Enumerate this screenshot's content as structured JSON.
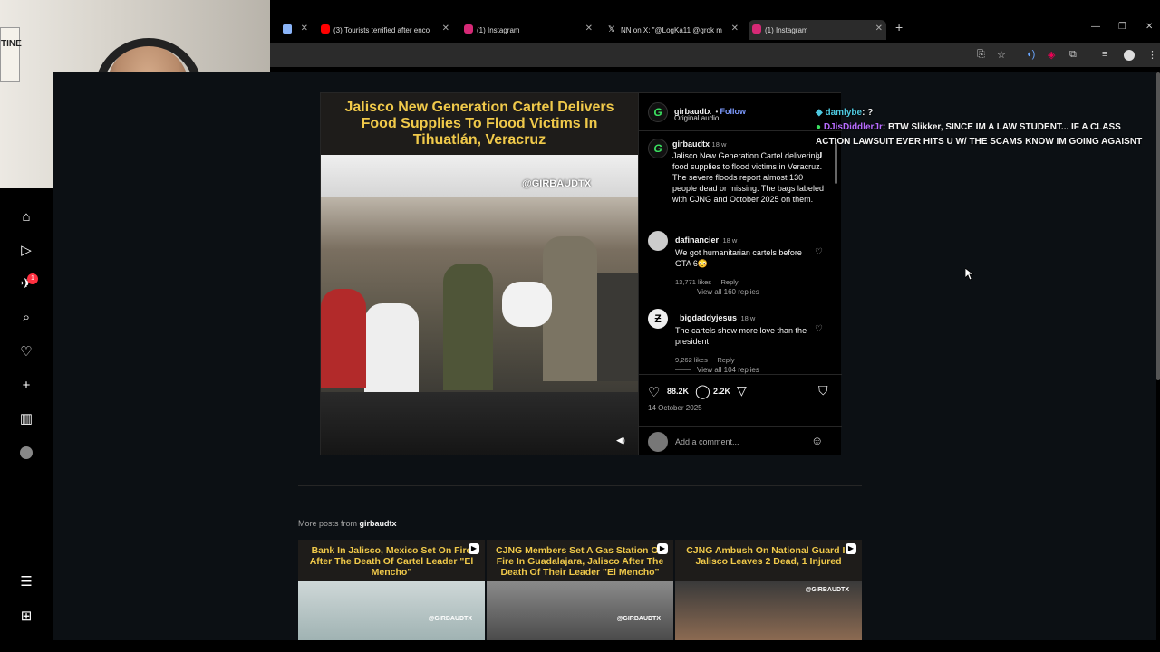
{
  "tabs": [
    {
      "label": "",
      "color": "#8ab4f8"
    },
    {
      "label": "(3) Tourists terrified after enco",
      "color": "#ff0000"
    },
    {
      "label": "(1) Instagram",
      "color": "#d62976"
    },
    {
      "label": "NN on X: \"@LogKa11 @grok m",
      "color": "#ffffff"
    },
    {
      "label": "(1) Instagram",
      "color": "#d62976"
    }
  ],
  "post": {
    "media_title": "Jalisco New Generation Cartel Delivers Food Supplies To Flood Victims In Tihuatlán, Veracruz",
    "watermark": "@GIRBAUDTX",
    "author": "girbaudtx",
    "follow": "Follow",
    "audio": "Original audio",
    "caption_time": "18 w",
    "caption": "Jalisco New Generation Cartel delivering food supplies to flood victims in Veracruz. The severe floods report almost 130 people dead or missing. The bags labeled with CJNG and October 2025 on them.",
    "comments": [
      {
        "user": "dafinancier",
        "time": "18 w",
        "text": "We got humanitarian cartels before GTA 6😳",
        "likes": "13,771 likes",
        "reply": "Reply",
        "view_replies": "View all 160 replies"
      },
      {
        "user": "_bigdaddyjesus",
        "time": "18 w",
        "text": "The cartels show more love than the president",
        "likes": "9,262 likes",
        "reply": "Reply",
        "view_replies": "View all 104 replies"
      }
    ],
    "likes": "88.2K",
    "comment_count": "2.2K",
    "date": "14 October 2025",
    "add_comment_placeholder": "Add a comment..."
  },
  "chat": [
    {
      "user": "damlybe",
      "message": ": ?"
    },
    {
      "user": "DJisDiddlerJr",
      "message": ": BTW Slikker, SINCE IM A LAW STUDENT... IF A CLASS ACTION LAWSUIT EVER HITS U W/ THE SCAMS KNOW IM GOING AGAISNT U"
    }
  ],
  "more_posts": {
    "label": "More posts from",
    "user": "girbaudtx",
    "items": [
      {
        "title": "Bank In Jalisco, Mexico Set On Fire After The Death Of Cartel Leader \"El Mencho\"",
        "watermark": "@GIRBAUDTX"
      },
      {
        "title": "CJNG Members Set A Gas Station On Fire In Guadalajara, Jalisco After The Death Of Their Leader \"El Mencho\"",
        "watermark": "@GIRBAUDTX"
      },
      {
        "title": "CJNG Ambush On National Guard In Jalisco Leaves 2 Dead, 1 Injured",
        "watermark": "@GIRBAUDTX"
      }
    ]
  },
  "nav": {
    "notification_badge": "1",
    "icons": [
      "home-icon",
      "reels-icon",
      "messages-icon",
      "search-icon",
      "heart-icon",
      "create-icon",
      "dashboard-icon",
      "profile-avatar",
      "menu-icon",
      "more-apps-icon"
    ]
  },
  "webcam": {
    "sign_text": "TINE"
  }
}
